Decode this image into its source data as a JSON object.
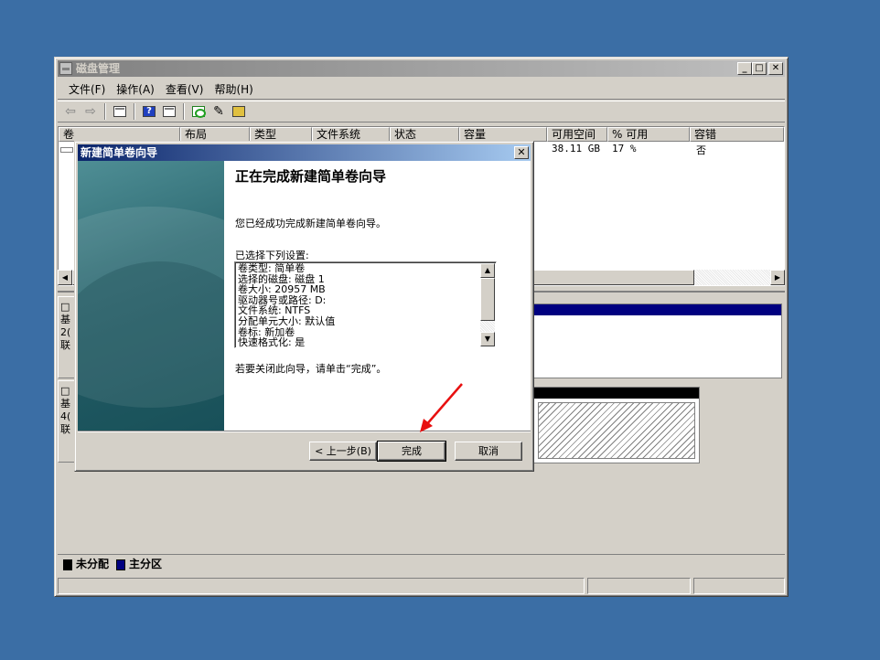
{
  "window": {
    "title": "磁盘管理",
    "min": "_",
    "max": "□",
    "close": "✕"
  },
  "menu": [
    {
      "label": "文件(F)"
    },
    {
      "label": "操作(A)"
    },
    {
      "label": "查看(V)"
    },
    {
      "label": "帮助(H)"
    }
  ],
  "toolbar": {
    "icons": [
      "back-icon",
      "forward-icon",
      "up-level-icon",
      "help-icon",
      "properties-icon",
      "refresh-icon",
      "edit-icon",
      "export-icon"
    ]
  },
  "volume_list": {
    "columns": [
      "卷",
      "布局",
      "类型",
      "文件系统",
      "状态",
      "容量",
      "可用空间",
      "% 可用",
      "容错"
    ],
    "row": {
      "free": "38.11 GB",
      "percent": "17 %",
      "fault_tolerance": "否"
    }
  },
  "disk_area": {
    "disk0_label": "□\n基\n2(\n联",
    "disk1_label": "□\n基\n4(\n联"
  },
  "legend": {
    "unallocated": "未分配",
    "primary": "主分区",
    "unallocated_color": "#000000",
    "primary_color": "#000080"
  },
  "dialog": {
    "title": "新建简单卷向导",
    "close": "✕",
    "heading": "正在完成新建简单卷向导",
    "success_text": "您已经成功完成新建简单卷向导。",
    "settings_label": "已选择下列设置:",
    "settings": [
      "卷类型: 简单卷",
      "选择的磁盘: 磁盘 1",
      "卷大小: 20957 MB",
      "驱动器号或路径: D:",
      "文件系统: NTFS",
      "分配单元大小: 默认值",
      "卷标: 新加卷",
      "快速格式化: 是"
    ],
    "close_hint": "若要关闭此向导，请单击“完成”。",
    "back_button": "< 上一步(B)",
    "finish_button": "完成",
    "cancel_button": "取消"
  }
}
